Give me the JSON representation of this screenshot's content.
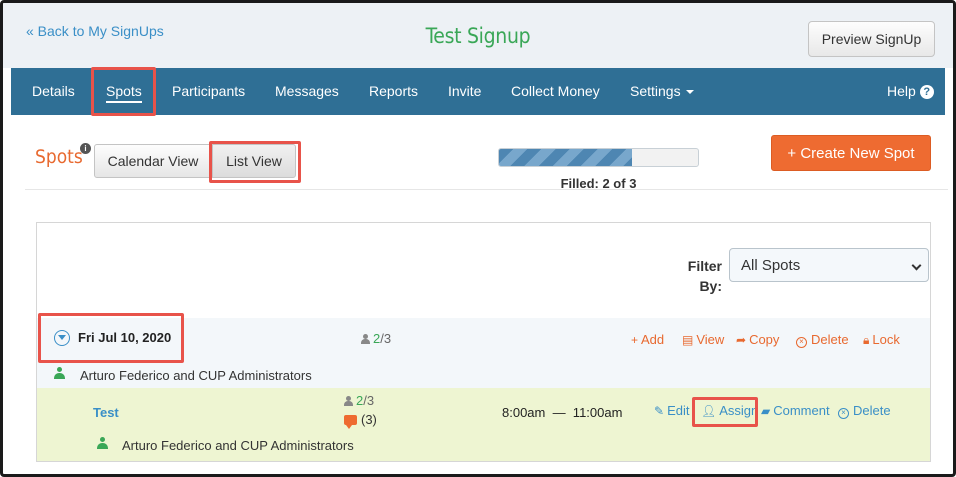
{
  "header": {
    "back_link": "« Back to My SignUps",
    "title": "Test Signup",
    "preview_button": "Preview SignUp"
  },
  "nav": {
    "items": [
      {
        "label": "Details"
      },
      {
        "label": "Spots",
        "active": true
      },
      {
        "label": "Participants"
      },
      {
        "label": "Messages"
      },
      {
        "label": "Reports"
      },
      {
        "label": "Invite"
      },
      {
        "label": "Collect Money"
      },
      {
        "label": "Settings"
      }
    ],
    "help": "Help"
  },
  "spots_toolbar": {
    "title": "Spots",
    "calendar_view": "Calendar View",
    "list_view": "List View",
    "progress_fraction": 0.67,
    "filled_text": "Filled: 2 of 3",
    "create_button": "+ Create New Spot"
  },
  "filter": {
    "label_line1": "Filter",
    "label_line2": "By:",
    "selected": "All Spots"
  },
  "date_group": {
    "date": "Fri Jul 10, 2020",
    "count_filled": "2",
    "count_total": "/3",
    "actions": {
      "add": "Add",
      "view": "View",
      "copy": "Copy",
      "delete": "Delete",
      "lock": "Lock"
    },
    "owner": "Arturo Federico and CUP Administrators"
  },
  "spot": {
    "name": "Test",
    "count_filled": "2",
    "count_total": "/3",
    "comment_count": "(3)",
    "time": "8:00am  —  11:00am",
    "actions": {
      "edit": "Edit",
      "assign": "Assign",
      "comment": "Comment",
      "delete": "Delete"
    },
    "owner": "Arturo Federico and CUP Administrators"
  },
  "colors": {
    "nav_bg": "#2f6f95",
    "accent_orange": "#ee6b31",
    "title_green": "#3aa757",
    "link_blue": "#3a8fc7",
    "highlight_red": "#e8534a",
    "spot_row_bg": "#eef5d2"
  }
}
